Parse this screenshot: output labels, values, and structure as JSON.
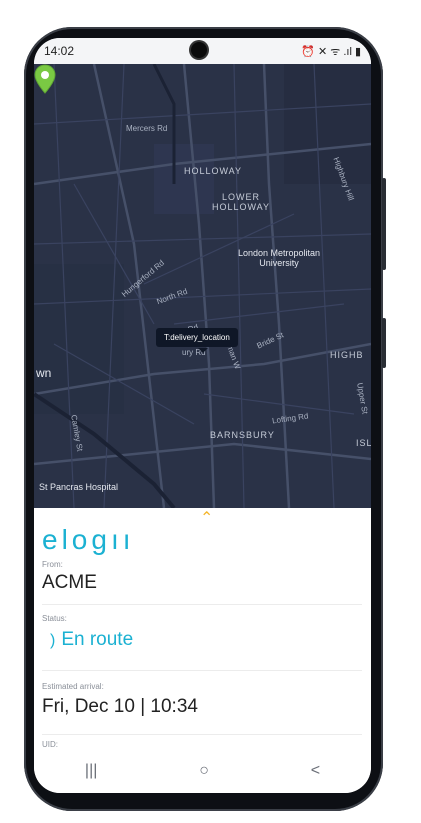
{
  "status_bar": {
    "time": "14:02",
    "icons": "⏰ ✕ ᯤ .ıl ▮"
  },
  "map": {
    "labels": {
      "mercers_rd": "Mercers Rd",
      "holloway": "HOLLOWAY",
      "lower_holloway": "LOWER\nHOLLOWAY",
      "university": "London Metropolitan\nUniversity",
      "highbury_hill": "Highbury Hill",
      "hungerford_rd": "Hungerford Rd",
      "north_rd": "North Rd",
      "market_rd": "Market Rd",
      "romilly": "Roman W",
      "bride_st": "Bride St",
      "bury_rd": "ury Rd",
      "highb": "HIGHB",
      "wn": "wn",
      "camley_st": "Camley St",
      "lofting_rd": "Lofting Rd",
      "upper_st": "Upper St",
      "barnsbury": "BARNSBURY",
      "isl": "ISL",
      "st_pancras": "St Pancras Hospital"
    },
    "tooltip": "T:delivery_location"
  },
  "panel": {
    "logo": "elogıı",
    "from_label": "From:",
    "from_value": "ACME",
    "status_label": "Status:",
    "status_value": "En route",
    "arrival_label": "Estimated arrival:",
    "arrival_value": "Fri, Dec 10 | 10:34",
    "uid_label": "UID:"
  },
  "nav": {
    "recents": "|||",
    "home": "○",
    "back": "<"
  },
  "colors": {
    "accent": "#1bb1d2",
    "pin": "#7ac943",
    "map_bg": "#2a3247"
  }
}
